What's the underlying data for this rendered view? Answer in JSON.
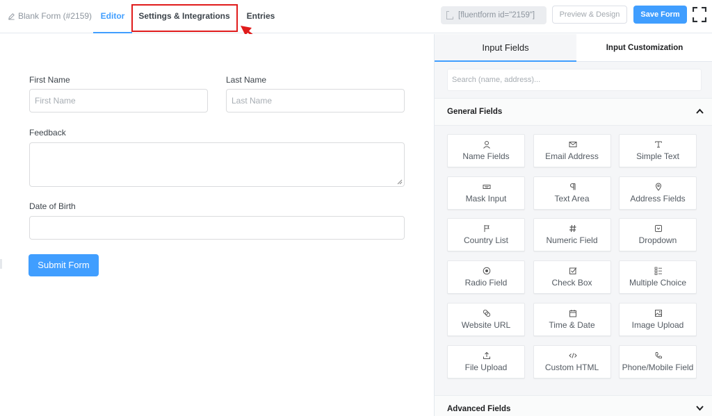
{
  "topbar": {
    "form_title": "Blank Form (#2159)",
    "tabs": [
      {
        "label": "Editor",
        "active": true
      },
      {
        "label": "Settings & Integrations",
        "active": false
      },
      {
        "label": "Entries",
        "active": false
      }
    ],
    "shortcode": "[fluentform id=\"2159\"]",
    "preview_label": "Preview & Design",
    "save_label": "Save Form",
    "highlight_color": "#e01b1b",
    "accent_color": "#409eff"
  },
  "editor": {
    "fields": {
      "first_name": {
        "label": "First Name",
        "placeholder": "First Name"
      },
      "last_name": {
        "label": "Last Name",
        "placeholder": "Last Name"
      },
      "feedback": {
        "label": "Feedback"
      },
      "dob": {
        "label": "Date of Birth"
      }
    },
    "submit_label": "Submit Form"
  },
  "panel": {
    "tabs": [
      {
        "label": "Input Fields",
        "active": true
      },
      {
        "label": "Input Customization",
        "active": false
      }
    ],
    "search_placeholder": "Search (name, address)...",
    "general_section": {
      "title": "General Fields",
      "expanded": true
    },
    "advanced_section": {
      "title": "Advanced Fields",
      "expanded": false
    },
    "general_fields": [
      {
        "label": "Name Fields",
        "icon": "person-icon"
      },
      {
        "label": "Email Address",
        "icon": "envelope-icon"
      },
      {
        "label": "Simple Text",
        "icon": "text-cursor-icon"
      },
      {
        "label": "Mask Input",
        "icon": "keyboard-icon"
      },
      {
        "label": "Text Area",
        "icon": "paragraph-icon"
      },
      {
        "label": "Address Fields",
        "icon": "map-pin-icon"
      },
      {
        "label": "Country List",
        "icon": "flag-icon"
      },
      {
        "label": "Numeric Field",
        "icon": "hash-icon"
      },
      {
        "label": "Dropdown",
        "icon": "dropdown-icon"
      },
      {
        "label": "Radio Field",
        "icon": "radio-icon"
      },
      {
        "label": "Check Box",
        "icon": "checkbox-icon"
      },
      {
        "label": "Multiple Choice",
        "icon": "list-icon"
      },
      {
        "label": "Website URL",
        "icon": "link-icon"
      },
      {
        "label": "Time & Date",
        "icon": "calendar-icon"
      },
      {
        "label": "Image Upload",
        "icon": "image-icon"
      },
      {
        "label": "File Upload",
        "icon": "upload-icon"
      },
      {
        "label": "Custom HTML",
        "icon": "code-icon"
      },
      {
        "label": "Phone/Mobile Field",
        "icon": "phone-icon"
      }
    ]
  }
}
